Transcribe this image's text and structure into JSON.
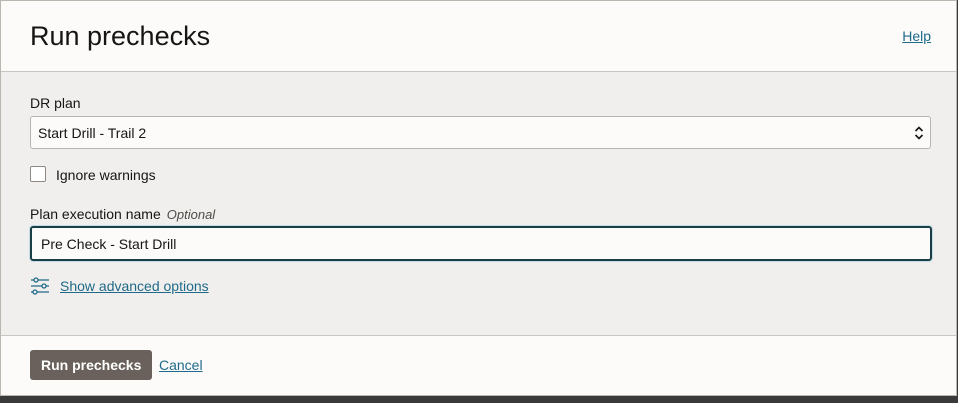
{
  "dialog": {
    "title": "Run prechecks",
    "help_label": "Help"
  },
  "form": {
    "dr_plan": {
      "label": "DR plan",
      "selected": "Start Drill - Trail 2"
    },
    "ignore_warnings": {
      "label": "Ignore warnings",
      "checked": false
    },
    "execution_name": {
      "label": "Plan execution name",
      "optional_label": "Optional",
      "value": "Pre Check - Start Drill"
    },
    "advanced": {
      "icon": "sliders-icon",
      "label": "Show advanced options"
    }
  },
  "footer": {
    "primary_label": "Run prechecks",
    "cancel_label": "Cancel"
  },
  "colors": {
    "link": "#1f6a8a",
    "primary_button": "#6a615c",
    "focus_border": "#1b3d46",
    "panel_bg": "#f1efed"
  }
}
